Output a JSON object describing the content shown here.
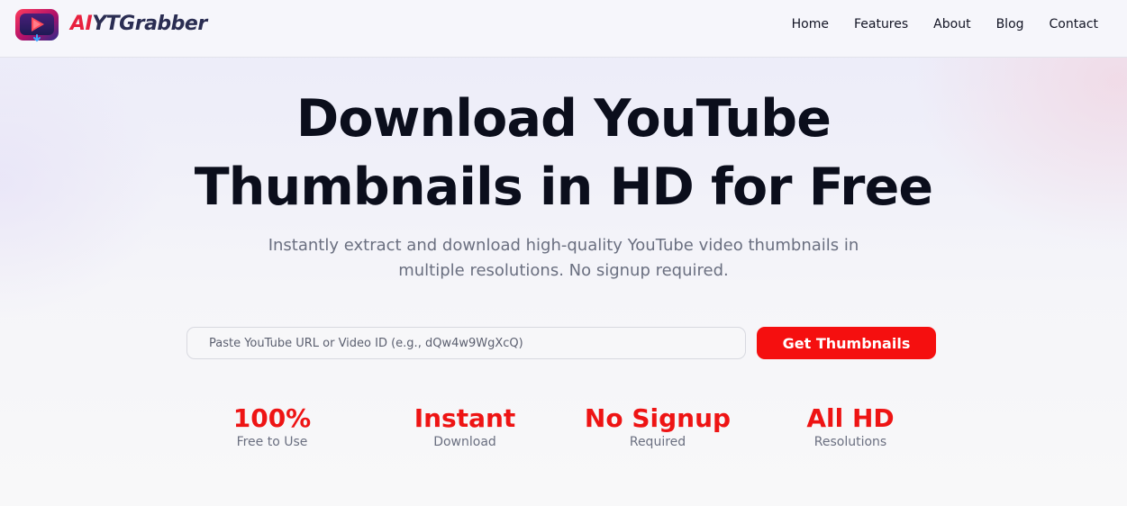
{
  "brand": {
    "part_ai": "AI",
    "part_yt": "YT",
    "part_grabber": "Grabber"
  },
  "nav": {
    "items": [
      {
        "label": "Home"
      },
      {
        "label": "Features"
      },
      {
        "label": "About"
      },
      {
        "label": "Blog"
      },
      {
        "label": "Contact"
      }
    ]
  },
  "hero": {
    "title_line1": "Download YouTube",
    "title_line2": "Thumbnails in HD for Free",
    "subtitle_line1": "Instantly extract and download high-quality YouTube video thumbnails in",
    "subtitle_line2": "multiple resolutions. No signup required."
  },
  "search": {
    "placeholder": "Paste YouTube URL or Video ID (e.g., dQw4w9WgXcQ)",
    "value": "",
    "button_label": "Get Thumbnails"
  },
  "stats": [
    {
      "value": "100%",
      "label": "Free to Use"
    },
    {
      "value": "Instant",
      "label": "Download"
    },
    {
      "value": "No Signup",
      "label": "Required"
    },
    {
      "value": "All HD",
      "label": "Resolutions"
    }
  ],
  "colors": {
    "accent": "#f50f0f",
    "stat": "#ee1414",
    "brand_red": "#e8213f",
    "brand_navy": "#2a2d52"
  },
  "icons": {
    "logo": "play-download-logo-icon"
  }
}
